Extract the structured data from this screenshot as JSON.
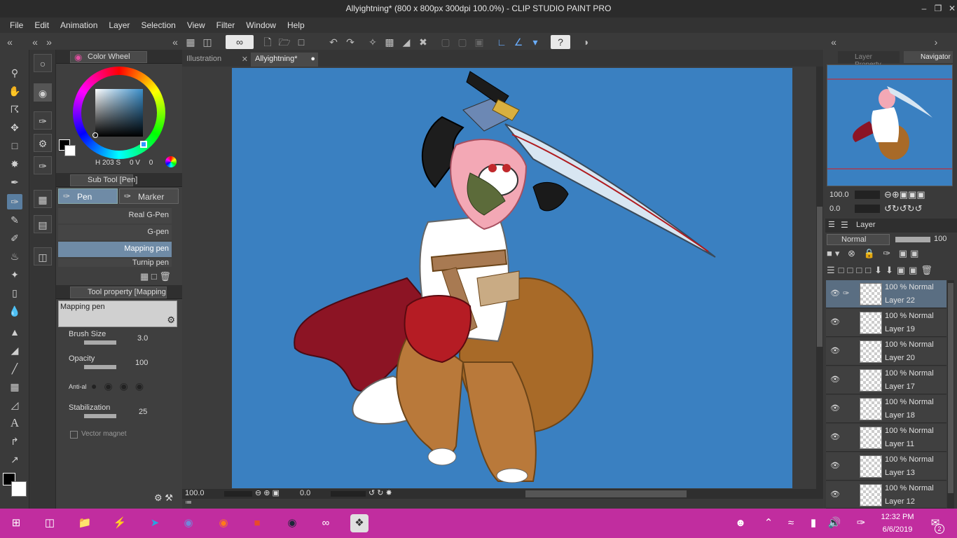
{
  "window": {
    "title": "Allyightning* (800 x 800px 300dpi 100.0%) - CLIP STUDIO PAINT PRO"
  },
  "menu": [
    "File",
    "Edit",
    "Animation",
    "Layer",
    "Selection",
    "View",
    "Filter",
    "Window",
    "Help"
  ],
  "tabs": {
    "tab1": "Illustration",
    "tab2": "Allyightning*"
  },
  "color_wheel": {
    "title": "Color Wheel",
    "h_label": "H",
    "h_value": "203",
    "s_label": "S",
    "s_value": "0",
    "v_label": "V",
    "v_value": "0",
    "accent": "#3a80c1"
  },
  "sub_tool": {
    "title": "Sub Tool [Pen]",
    "tab_pen": "Pen",
    "tab_marker": "Marker",
    "items": [
      "Real G-Pen",
      "G-pen",
      "Mapping pen",
      "Turnip pen"
    ]
  },
  "tool_property": {
    "title": "Tool property [Mapping",
    "preset": "Mapping pen",
    "brush_size_label": "Brush Size",
    "brush_size_value": "3.0",
    "opacity_label": "Opacity",
    "opacity_value": "100",
    "anti_label": "Anti-al",
    "stabilization_label": "Stabilization",
    "stabilization_value": "25",
    "vector_magnet_label": "Vector magnet"
  },
  "canvas_status": {
    "zoom": "100.0",
    "rotation": "0.0"
  },
  "navigator": {
    "tab_layer_property": "Layer Property",
    "tab_navigator": "Navigator",
    "zoom": "100.0",
    "rotation": "0.0"
  },
  "layers": {
    "title": "Layer",
    "blend_mode": "Normal",
    "opacity": "100",
    "rows": [
      {
        "mode": "100 % Normal",
        "name": "Layer 22"
      },
      {
        "mode": "100 % Normal",
        "name": "Layer 19"
      },
      {
        "mode": "100 % Normal",
        "name": "Layer 20"
      },
      {
        "mode": "100 % Normal",
        "name": "Layer 17"
      },
      {
        "mode": "100 % Normal",
        "name": "Layer 18"
      },
      {
        "mode": "100 % Normal",
        "name": "Layer 11"
      },
      {
        "mode": "100 % Normal",
        "name": "Layer 13"
      },
      {
        "mode": "100 % Normal",
        "name": "Layer 12"
      }
    ]
  },
  "taskbar": {
    "time": "12:32 PM",
    "date": "6/6/2019",
    "notifications": "2",
    "color": "#c12d9f"
  }
}
